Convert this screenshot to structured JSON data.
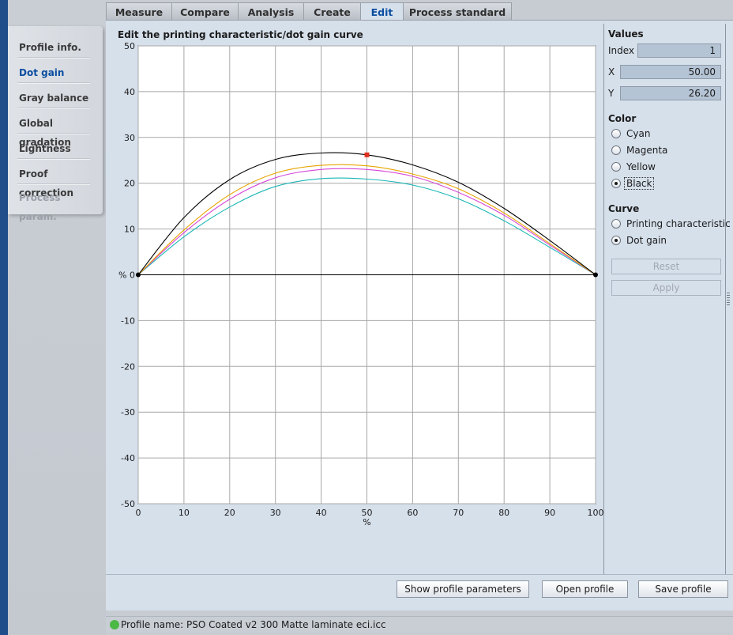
{
  "tabs": [
    "Measure",
    "Compare",
    "Analysis",
    "Create",
    "Edit",
    "Process standard"
  ],
  "active_tab": "Edit",
  "sidebar": {
    "items": [
      {
        "label": "Profile info."
      },
      {
        "label": "Dot gain"
      },
      {
        "label": "Gray balance"
      },
      {
        "label": "Global gradation"
      },
      {
        "label": "Lightness"
      },
      {
        "label": "Proof correction"
      },
      {
        "label": "Process param."
      }
    ],
    "active": "Dot gain",
    "disabled": "Process param."
  },
  "chart_title": "Edit the printing characteristic/dot gain curve",
  "values": {
    "title": "Values",
    "index_label": "Index",
    "index": "1",
    "x_label": "X",
    "x": "50.00",
    "y_label": "Y",
    "y": "26.20"
  },
  "color": {
    "title": "Color",
    "options": [
      "Cyan",
      "Magenta",
      "Yellow",
      "Black"
    ],
    "selected": "Black"
  },
  "curve": {
    "title": "Curve",
    "options": [
      "Printing characteristic",
      "Dot gain"
    ],
    "selected": "Dot gain"
  },
  "buttons": {
    "reset": "Reset",
    "apply": "Apply",
    "show_params": "Show profile parameters",
    "open_profile": "Open profile",
    "save_profile": "Save profile"
  },
  "status": {
    "text": "Profile name: PSO  Coated  v2  300  Matte  laminate  eci.icc",
    "indicator_color": "#4cb846"
  },
  "chart_data": {
    "type": "line",
    "title": "Edit the printing characteristic/dot gain curve",
    "xlabel": "%",
    "ylabel": "%",
    "xlim": [
      0,
      100
    ],
    "ylim": [
      -50,
      50
    ],
    "x_ticks": [
      0,
      10,
      20,
      30,
      40,
      50,
      60,
      70,
      80,
      90,
      100
    ],
    "y_ticks": [
      50,
      40,
      30,
      20,
      10,
      0,
      -10,
      -20,
      -30,
      -40,
      -50
    ],
    "y_zero_label": "% 0",
    "grid": true,
    "x": [
      0,
      10,
      20,
      30,
      40,
      50,
      60,
      70,
      80,
      90,
      100
    ],
    "series": [
      {
        "color": "#000000",
        "values": [
          0,
          12.5,
          20.8,
          25.2,
          26.6,
          26.2,
          24.0,
          20.2,
          14.5,
          7.5,
          0
        ],
        "control_points": [
          [
            0,
            0
          ],
          [
            100,
            0
          ]
        ],
        "marker": {
          "x": 50,
          "y": 26.2,
          "color": "#e03020"
        }
      },
      {
        "color": "#e8a400",
        "values": [
          0,
          9.8,
          17.5,
          22.2,
          23.9,
          23.8,
          22.0,
          18.8,
          13.5,
          6.8,
          0
        ]
      },
      {
        "color": "#d646d6",
        "values": [
          0,
          9.2,
          16.5,
          21.2,
          23.0,
          23.0,
          21.5,
          18.0,
          13.0,
          6.5,
          0
        ]
      },
      {
        "color": "#1ab6b6",
        "values": [
          0,
          8.3,
          14.8,
          19.3,
          21.0,
          20.9,
          19.6,
          16.6,
          11.8,
          6.0,
          0
        ]
      }
    ]
  }
}
